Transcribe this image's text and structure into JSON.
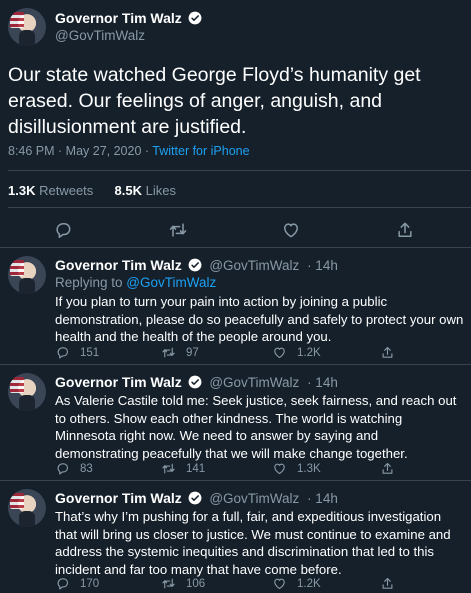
{
  "main_tweet": {
    "name": "Governor Tim Walz",
    "handle": "@GovTimWalz",
    "text": "Our state watched George Floyd’s humanity get erased. Our feelings of anger, anguish, and disillusionment are justified.",
    "time": "8:46 PM · May 27, 2020 · ",
    "source": "Twitter for iPhone",
    "retweets_count": "1.3K",
    "retweets_label": "Retweets",
    "likes_count": "8.5K",
    "likes_label": "Likes"
  },
  "replies": [
    {
      "name": "Governor Tim Walz",
      "handle": "@GovTimWalz",
      "time": "· 14h",
      "replying_prefix": "Replying to ",
      "replying_handle": "@GovTimWalz",
      "text": "If you plan to turn your pain into action by joining a public demonstration, please do so peacefully and safely to protect your own health and the health of the people around you.",
      "replies": "151",
      "retweets": "97",
      "likes": "1.2K"
    },
    {
      "name": "Governor Tim Walz",
      "handle": "@GovTimWalz",
      "time": "· 14h",
      "text": "As Valerie Castile told me: Seek justice, seek fairness, and reach out to others. Show each other kindness. The world is watching Minnesota right now. We need to answer by saying and demonstrating peacefully that we will make change together.",
      "replies": "83",
      "retweets": "141",
      "likes": "1.3K"
    },
    {
      "name": "Governor Tim Walz",
      "handle": "@GovTimWalz",
      "time": "· 14h",
      "text": "That’s why I’m pushing for a full, fair, and expeditious investigation that will bring us closer to justice. We must continue to examine and address the systemic inequities and discrimination that led to this incident and far too many that have come before.",
      "replies": "170",
      "retweets": "106",
      "likes": "1.2K"
    }
  ],
  "icons": {
    "reply": "reply-icon",
    "retweet": "retweet-icon",
    "like": "like-icon",
    "share": "share-icon",
    "verified": "verified-badge-icon",
    "more": "more-icon"
  },
  "colors": {
    "background": "#15202b",
    "secondary_text": "#8899a6",
    "link": "#1da1f2",
    "divider": "#38444d"
  }
}
